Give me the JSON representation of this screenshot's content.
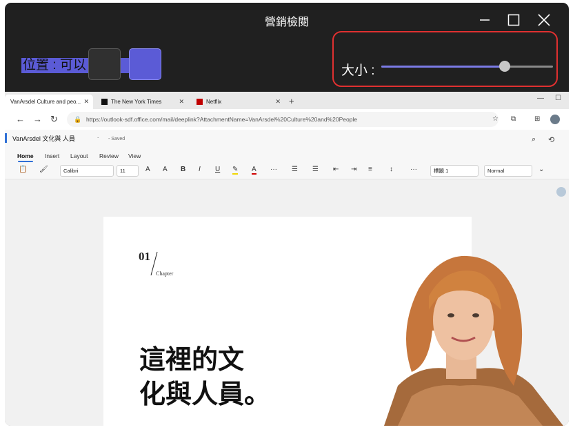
{
  "window": {
    "title": "營銷檢閱"
  },
  "position": {
    "label": "位置 : 可以"
  },
  "size": {
    "label": "大小 :",
    "value": 0.72
  },
  "browser": {
    "tabs": [
      {
        "label": "VanArsdel Culture and peo..."
      },
      {
        "label": "The New York Times"
      },
      {
        "label": "Netflix"
      }
    ],
    "url": "https://outlook-sdf.office.com/mail/deeplink?AttachmentName=VanArsdel%20Culture%20and%20People"
  },
  "document": {
    "name": "VanArsdel 文化與 人員",
    "dot": ".",
    "status": "- Saved",
    "ribbon_tabs": [
      "Home",
      "Insert",
      "Layout",
      "Review",
      "View"
    ],
    "font_name": "Calibri",
    "font_size": "11",
    "heading_style": "標題 1",
    "style": "Normal",
    "chapter_number": "01",
    "chapter_label": "Chapter",
    "headline_line1": "這裡的文",
    "headline_line2": "化與人員。"
  },
  "colors": {
    "accent": "#5b5bd6",
    "highlight_border": "#e03030",
    "window_bg": "#202020"
  }
}
